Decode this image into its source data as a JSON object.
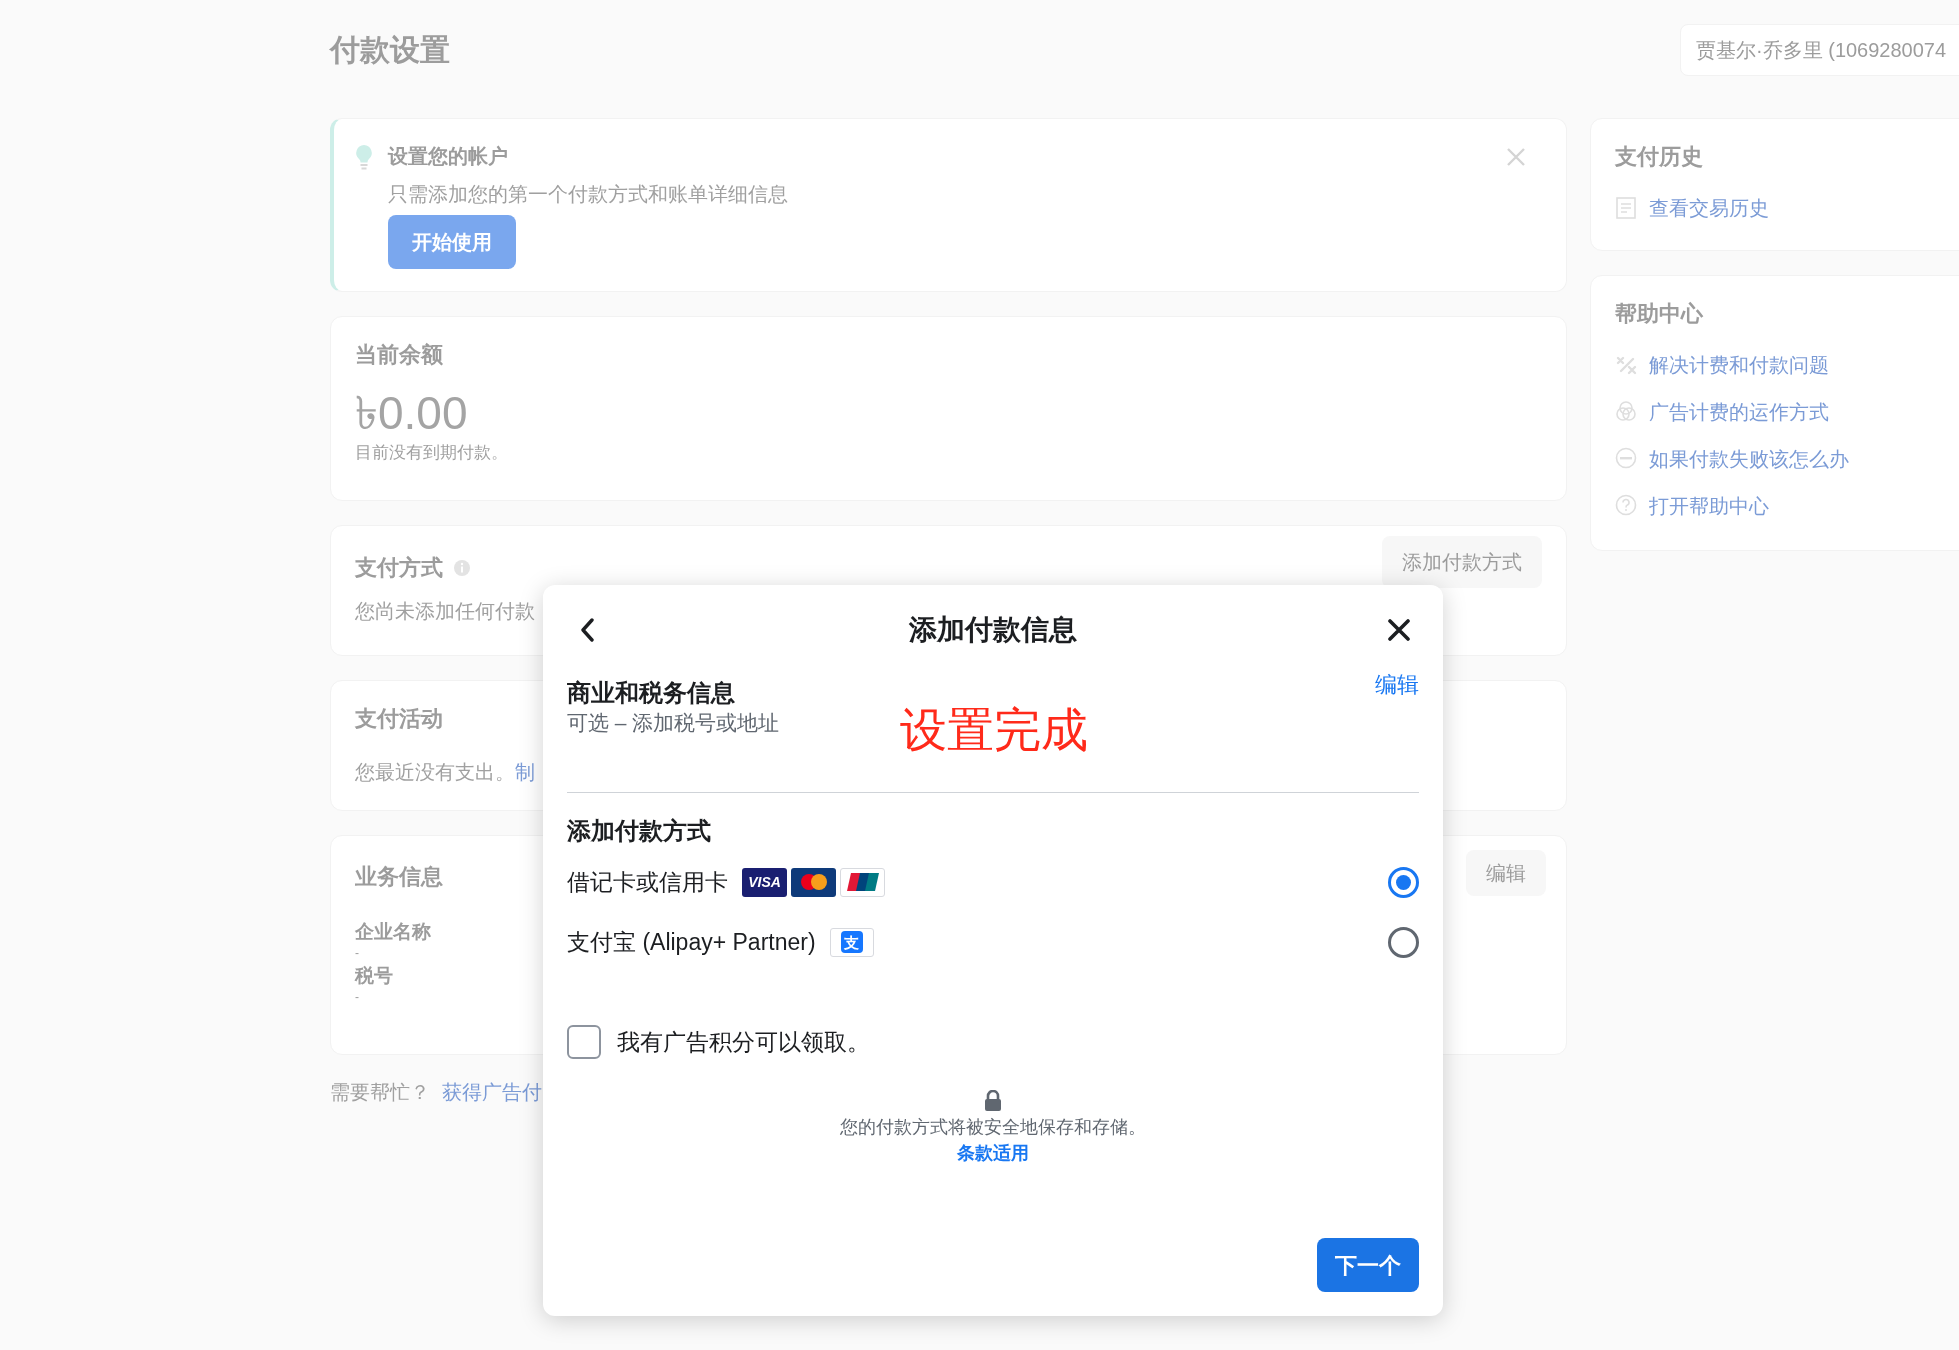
{
  "page": {
    "title": "付款设置",
    "account_selector": "贾基尔·乔多里 (1069280074"
  },
  "setup_card": {
    "title": "设置您的帐户",
    "description": "只需添加您的第一个付款方式和账单详细信息",
    "button": "开始使用"
  },
  "balance_card": {
    "title": "当前余额",
    "amount": "৳0.00",
    "note": "目前没有到期付款。"
  },
  "payment_method_card": {
    "title": "支付方式",
    "button": "添加付款方式",
    "empty_text": "您尚未添加任何付款"
  },
  "activity_card": {
    "title": "支付活动",
    "text": "您最近没有支出。",
    "link": "制"
  },
  "business_card": {
    "title": "业务信息",
    "button": "编辑",
    "fields": [
      {
        "label": "企业名称",
        "value": "-"
      },
      {
        "label": "税号",
        "value": "-"
      }
    ]
  },
  "help_line": {
    "text": "需要帮忙？",
    "link": "获得广告付"
  },
  "sidebar": {
    "payment_history": {
      "title": "支付历史",
      "links": [
        {
          "label": "查看交易历史"
        }
      ]
    },
    "help_center": {
      "title": "帮助中心",
      "links": [
        {
          "label": "解决计费和付款问题"
        },
        {
          "label": "广告计费的运作方式"
        },
        {
          "label": "如果付款失败该怎么办"
        },
        {
          "label": "打开帮助中心"
        }
      ]
    }
  },
  "modal": {
    "title": "添加付款信息",
    "business_section": {
      "title": "商业和税务信息",
      "subtitle": "可选 – 添加税号或地址",
      "edit_link": "编辑"
    },
    "stamp": "设置完成",
    "methods_title": "添加付款方式",
    "methods": [
      {
        "label": "借记卡或信用卡",
        "selected": true,
        "badges": [
          {
            "kind": "visa",
            "text": "VISA"
          },
          {
            "kind": "mastercard"
          },
          {
            "kind": "unionpay"
          }
        ]
      },
      {
        "label": "支付宝 (Alipay+ Partner)",
        "selected": false,
        "badges": [
          {
            "kind": "alipay",
            "text": "支"
          }
        ]
      }
    ],
    "ad_credit": {
      "label": "我有广告积分可以领取。",
      "checked": false
    },
    "security_note": "您的付款方式将被安全地保存和存储。",
    "terms_link": "条款适用",
    "next_button": "下一个"
  }
}
